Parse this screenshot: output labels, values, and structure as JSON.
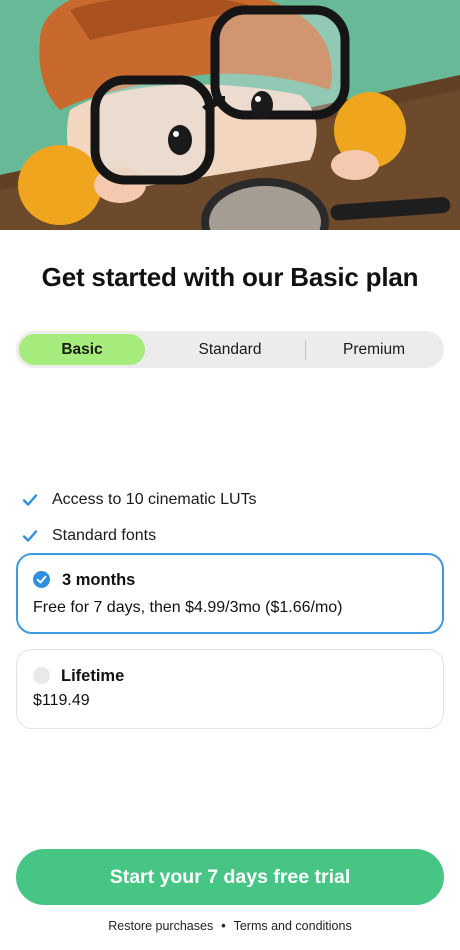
{
  "hero": {
    "image": "child-with-glasses-and-magnifier-illustration"
  },
  "title": "Get started with our Basic plan",
  "tabs": [
    {
      "label": "Basic",
      "selected": true
    },
    {
      "label": "Standard",
      "selected": false
    },
    {
      "label": "Premium",
      "selected": false
    }
  ],
  "features": [
    {
      "icon": "checkmark-icon",
      "label": "Access to 10 cinematic LUTs"
    },
    {
      "icon": "checkmark-icon",
      "label": "Standard fonts"
    }
  ],
  "plans": [
    {
      "title": "3 months",
      "description": "Free for 7 days, then $4.99/3mo ($1.66/mo)",
      "selected": true
    },
    {
      "title": "Lifetime",
      "description": "$119.49",
      "selected": false
    }
  ],
  "cta": {
    "label": "Start your 7 days free trial"
  },
  "footer": {
    "restore": "Restore purchases",
    "separator": "•",
    "terms": "Terms and conditions"
  },
  "colors": {
    "accent_green": "#47c584",
    "tab_selected": "#a6ec7c",
    "selected_border": "#3e9ae0",
    "check_blue": "#2f8fe0"
  }
}
